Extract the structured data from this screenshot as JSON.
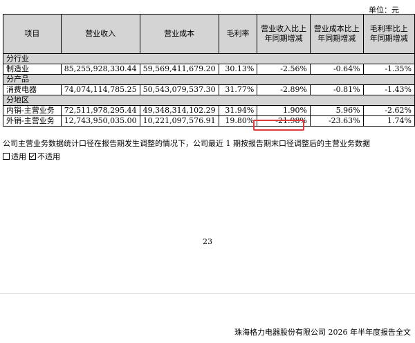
{
  "unit_label": "单位：元",
  "table": {
    "headers": [
      "项目",
      "营业收入",
      "营业成本",
      "毛利率",
      "营业收入比上年同期增减",
      "营业成本比上年同期增减",
      "毛利率比上年同期增减"
    ],
    "sections": [
      {
        "title": "分行业",
        "rows": [
          [
            "制造业",
            "85,255,928,330.44",
            "59,569,411,679.20",
            "30.13%",
            "-2.56%",
            "-0.64%",
            "-1.35%"
          ]
        ]
      },
      {
        "title": "分产品",
        "rows": [
          [
            "消费电器",
            "74,074,114,785.25",
            "50,543,079,537.30",
            "31.77%",
            "-2.89%",
            "-0.81%",
            "-1.43%"
          ]
        ]
      },
      {
        "title": "分地区",
        "rows": [
          [
            "内销-主营业务",
            "72,511,978,295.44",
            "49,348,314,102.29",
            "31.94%",
            "1.90%",
            "5.96%",
            "-2.62%"
          ],
          [
            "外销-主营业务",
            "12,743,950,035.00",
            "10,221,097,576.91",
            "19.80%",
            "-21.98%",
            "-23.63%",
            "1.74%"
          ]
        ]
      }
    ]
  },
  "highlight_color": "#e0393e",
  "note": "公司主营业务数据统计口径在报告期发生调整的情况下，公司最近 1 期按报告期末口径调整后的主营业务数据",
  "options": [
    {
      "label": "适用",
      "checked": false
    },
    {
      "label": "不适用",
      "checked": true
    }
  ],
  "page_number": "23",
  "footer": "珠海格力电器股份有限公司 2026 年半年度报告全文"
}
